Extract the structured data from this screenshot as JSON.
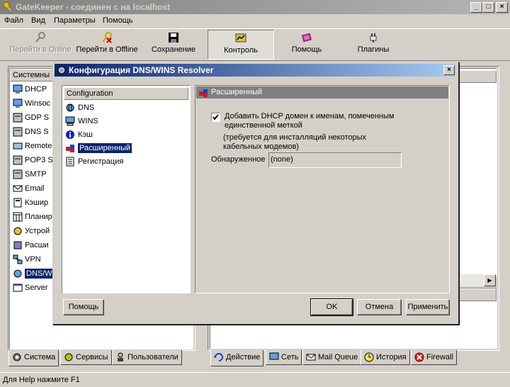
{
  "window": {
    "title": "GateKeeper - соединен с на localhost"
  },
  "menu": [
    "Файл",
    "Вид",
    "Параметры",
    "Помощь"
  ],
  "toolbar": {
    "go_online": "Перейти в Online",
    "go_offline": "Перейти в Offline",
    "save": "Сохранение",
    "control": "Контроль",
    "help": "Помощь",
    "plugins": "Плагины"
  },
  "left_panel": {
    "header": "Системны",
    "items": [
      "DHCP",
      "Winsoc",
      "GDP S",
      "DNS S",
      "Remote",
      "POP3 S",
      "SMTP",
      "Email",
      "Кэшир",
      "Планир",
      "Устрой",
      "Расши",
      "VPN",
      "DNS/W",
      "Server"
    ],
    "tabs": [
      "Система",
      "Сервисы",
      "Пользователи"
    ]
  },
  "right_panel": {
    "tabs": [
      "Действие",
      "Сеть",
      "Mail Queue",
      "История",
      "Firewall"
    ]
  },
  "status": {
    "text": "Для Help нажмите F1"
  },
  "dialog": {
    "title": "Конфигурация DNS/WINS Resolver",
    "tree_header": "Configuration",
    "tree_items": [
      "DNS",
      "WINS",
      "Кэш",
      "Расширенный",
      "Регистрация"
    ],
    "selected_index": 3,
    "page_title": "Расширенный",
    "checkbox_label_line1": "Добавить DHCP домен к именам, помеченным",
    "checkbox_label_line2": "единственной меткой",
    "checkbox_checked": true,
    "note_line1": "(требуется для инсталляций некоторых",
    "note_line2": "кабельных модемов)",
    "detected_label": "Обнаруженное",
    "detected_value": "(none)",
    "help_button": "Помощь",
    "ok_button": "OK",
    "cancel_button": "Отмена",
    "apply_button": "Применить"
  }
}
